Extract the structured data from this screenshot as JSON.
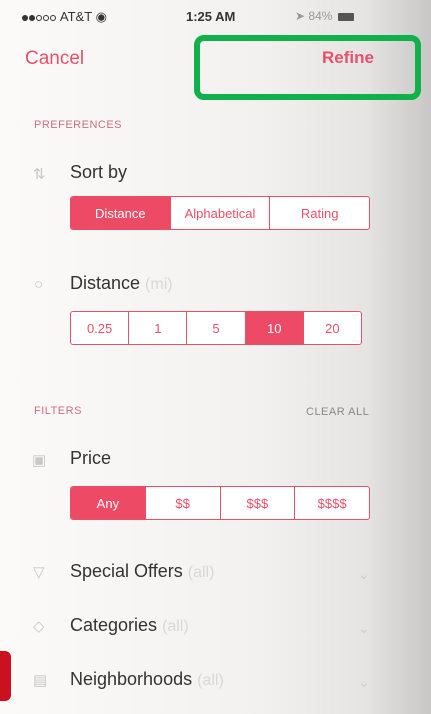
{
  "status_bar": {
    "carrier": "AT&T",
    "time": "1:25 AM",
    "battery": "84%"
  },
  "nav": {
    "cancel_label": "Cancel",
    "refine_label": "Refine"
  },
  "preferences": {
    "header": "PREFERENCES",
    "sort_by": {
      "label": "Sort by",
      "options": [
        "Distance",
        "Alphabetical",
        "Rating"
      ],
      "selected": "Distance"
    },
    "distance": {
      "label": "Distance",
      "unit": "(mi)",
      "options": [
        "0.25",
        "1",
        "5",
        "10",
        "20"
      ],
      "selected": "10"
    }
  },
  "filters": {
    "header": "FILTERS",
    "clear_all_label": "CLEAR ALL",
    "price": {
      "label": "Price",
      "options": [
        "Any",
        "$$",
        "$$$",
        "$$$$"
      ],
      "selected": "Any"
    },
    "rows": [
      {
        "label": "Special Offers",
        "value": "(all)",
        "icon": "tag-icon"
      },
      {
        "label": "Categories",
        "value": "(all)",
        "icon": "category-tag-icon"
      },
      {
        "label": "Neighborhoods",
        "value": "(all)",
        "icon": "buildings-icon"
      }
    ]
  },
  "colors": {
    "accent": "#ed4a66",
    "highlight": "#10b04a"
  }
}
